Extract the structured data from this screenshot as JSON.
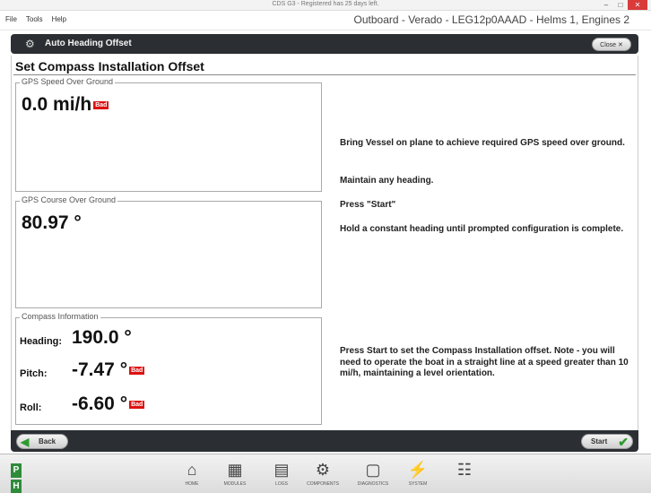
{
  "window": {
    "title": "CDS G3 - Registered has 25 days left.",
    "controls": [
      "minimize",
      "maximize",
      "close"
    ]
  },
  "menubar": {
    "items": [
      "File",
      "Tools",
      "Help"
    ],
    "vessel": "Outboard - Verado - LEG12p0AAAD - Helms 1, Engines 2"
  },
  "header": {
    "title": "Auto Heading Offset",
    "close_label": "Close"
  },
  "page": {
    "section_title": "Set Compass Installation Offset"
  },
  "gps_speed": {
    "legend": "GPS Speed Over Ground",
    "value": "0.0 mi/h",
    "badge": "Bad"
  },
  "gps_course": {
    "legend": "GPS Course Over Ground",
    "value": "80.97 °"
  },
  "compass": {
    "legend": "Compass Information",
    "heading_label": "Heading:",
    "heading_value": "190.0 °",
    "pitch_label": "Pitch:",
    "pitch_value": "-7.47 °",
    "pitch_badge": "Bad",
    "roll_label": "Roll:",
    "roll_value": "-6.60 °",
    "roll_badge": "Bad"
  },
  "instructions": {
    "line1": "Bring Vessel on plane to achieve required GPS speed over ground.",
    "line2": "Maintain any heading.",
    "line3": "Press \"Start\"",
    "line4": "Hold a constant heading until prompted configuration is complete.",
    "note": "Press Start to set the Compass Installation offset. Note - you will need to operate the boat in a straight line at a speed greater than 10 mi/h, maintaining a level orientation."
  },
  "footer": {
    "back_label": "Back",
    "start_label": "Start"
  },
  "bottombar": {
    "p_label": "P",
    "h_label": "H",
    "nav": [
      {
        "label": "HOME",
        "icon": "home-icon"
      },
      {
        "label": "MODULES",
        "icon": "modules-icon"
      },
      {
        "label": "LOGS",
        "icon": "logs-icon"
      },
      {
        "label": "COMPONENTS",
        "icon": "components-icon"
      },
      {
        "label": "DIAGNOSTICS",
        "icon": "diagnostics-icon"
      },
      {
        "label": "SYSTEM",
        "icon": "system-icon"
      },
      {
        "label": "",
        "icon": "manual-icon"
      }
    ]
  }
}
